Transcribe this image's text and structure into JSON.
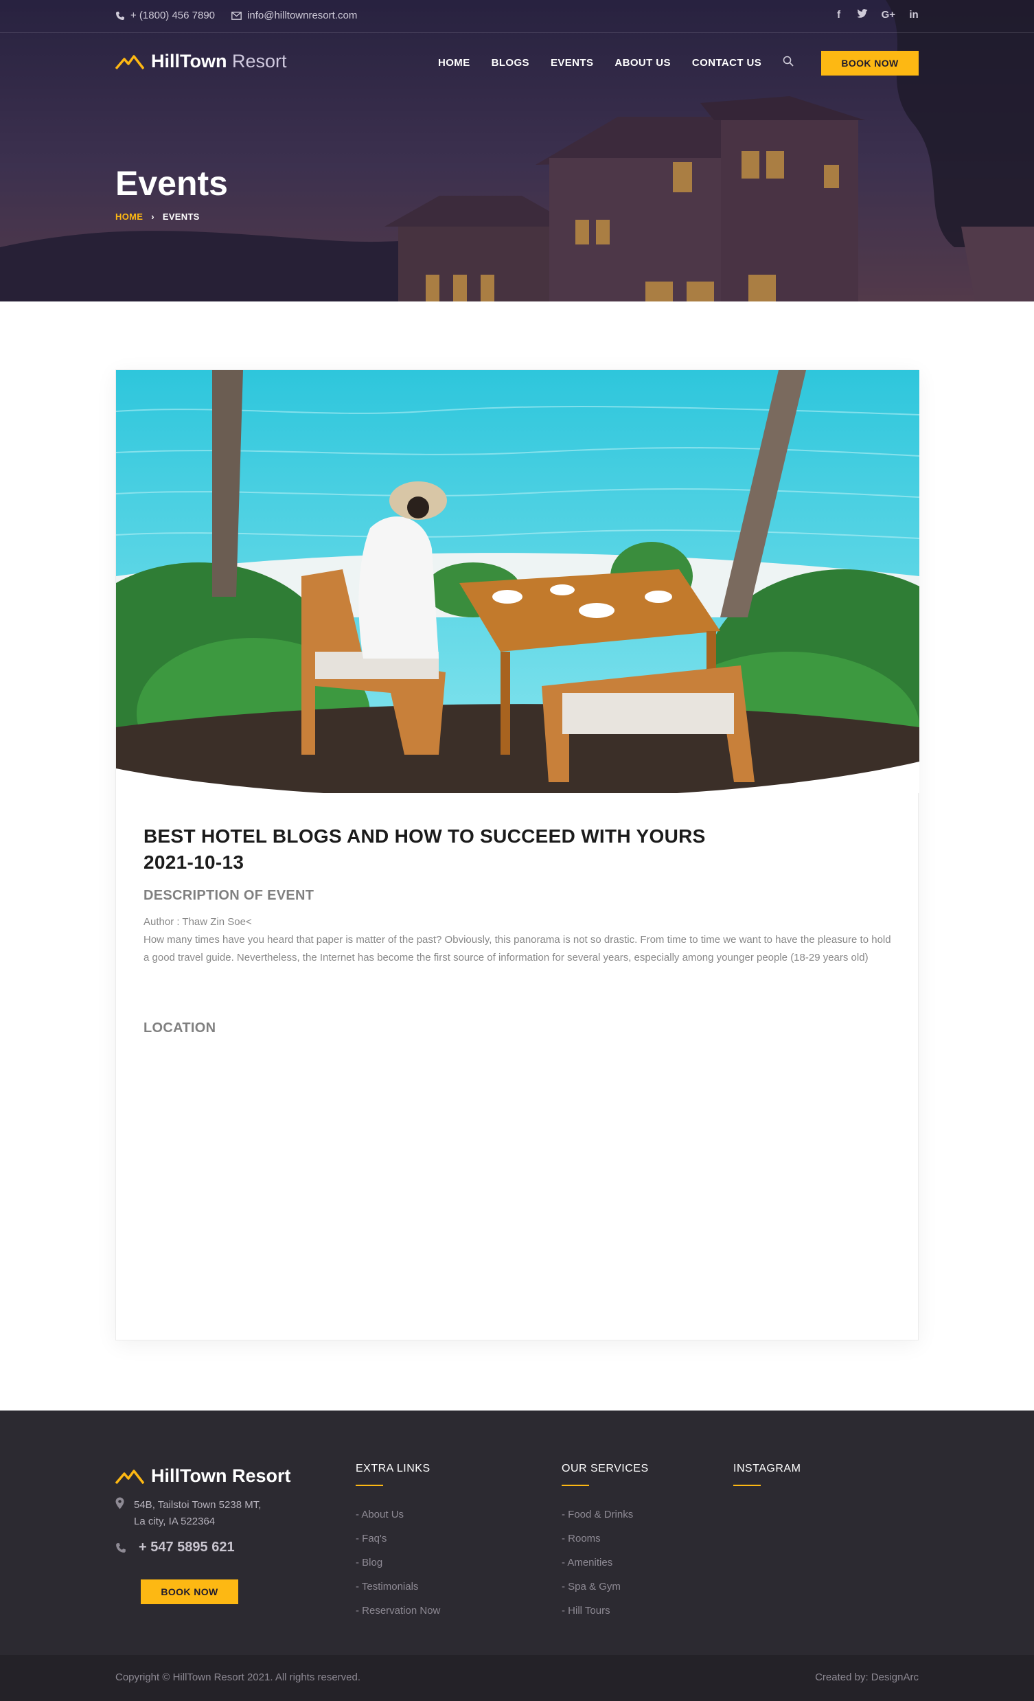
{
  "topbar": {
    "phone": "+ (1800) 456 7890",
    "email": "info@hilltownresort.com",
    "social": [
      "f",
      "t",
      "G+",
      "in"
    ]
  },
  "brand": {
    "name_bold": "HillTown",
    "name_light": "Resort"
  },
  "nav": {
    "items": [
      "HOME",
      "BLOGS",
      "EVENTS",
      "ABOUT US",
      "CONTACT US"
    ],
    "book_label": "BOOK NOW"
  },
  "hero": {
    "title": "Events",
    "breadcrumb": {
      "home": "HOME",
      "sep": "›",
      "current": "EVENTS"
    }
  },
  "post": {
    "title": "BEST HOTEL BLOGS AND HOW TO SUCCEED WITH YOURS",
    "date": "2021-10-13",
    "description_heading": "DESCRIPTION OF EVENT",
    "author": "Author : Thaw Zin Soe<",
    "description": "How many times have you heard that paper is matter of the past? Obviously, this panorama is not so drastic. From time to time we want to have the pleasure to hold a good travel guide. Nevertheless, the Internet has become the first source of information for several years, especially among younger people (18-29 years old)",
    "location_heading": "LOCATION"
  },
  "footer": {
    "brand": "HillTown Resort",
    "address_line1": "54B, Tailstoi Town 5238 MT,",
    "address_line2": "La city, IA 522364",
    "phone": "+ 547 5895 621",
    "book_label": "BOOK NOW",
    "columns": [
      {
        "title": "EXTRA LINKS",
        "items": [
          "- About Us",
          "- Faq's",
          "- Blog",
          "- Testimonials",
          "- Reservation Now"
        ]
      },
      {
        "title": "OUR SERVICES",
        "items": [
          "- Food & Drinks",
          "- Rooms",
          "- Amenities",
          "- Spa & Gym",
          "- Hill Tours"
        ]
      },
      {
        "title": "INSTAGRAM",
        "items": []
      }
    ]
  },
  "copyright": {
    "left": "Copyright © HillTown Resort 2021. All rights reserved.",
    "right": "Created by: DesignArc"
  },
  "colors": {
    "accent": "#fdb813",
    "header_bg": "#2e2846",
    "footer_bg": "#2c2a31",
    "copy_bg": "#242228"
  },
  "icons": [
    "phone-icon",
    "mail-icon",
    "facebook-icon",
    "twitter-icon",
    "google-plus-icon",
    "linkedin-icon",
    "search-icon",
    "map-pin-icon",
    "logo-mountain-icon"
  ]
}
